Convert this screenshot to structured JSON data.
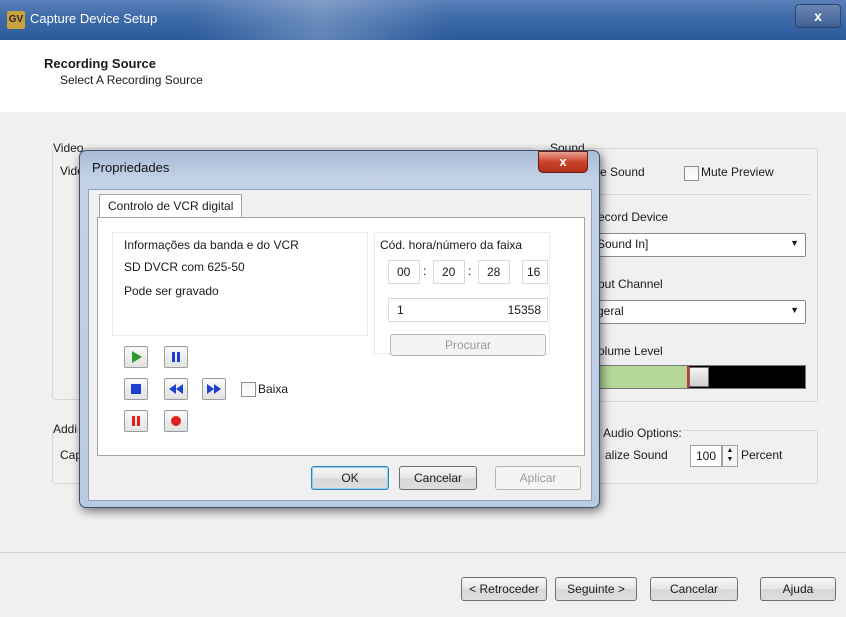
{
  "window": {
    "title": "Capture Device Setup",
    "logo": "GV",
    "close": "x"
  },
  "header": {
    "title": "Recording Source",
    "subtitle": "Select A Recording Source"
  },
  "video": {
    "group_label": "Video",
    "field_label_fragment": "Vide"
  },
  "sound": {
    "group_label": "Sound",
    "capture_sound_fragment": "re Sound",
    "mute_preview": "Mute Preview",
    "record_device_label": "ecord Device",
    "record_device_value": "Sound In]",
    "input_channel_label": "put Channel",
    "input_channel_value": "geral",
    "volume_label": "olume Level",
    "volume_level_fraction": 0.72
  },
  "additional": {
    "group_fragment": "Addi",
    "capture_fragment": "Cap",
    "audio_options_fragment": "Audio Options:",
    "normalize_fragment": "alize Sound",
    "percent_value": "100",
    "percent_label": "Percent"
  },
  "footer": {
    "back": "< Retroceder",
    "next": "Seguinte >",
    "cancel": "Cancelar",
    "help": "Ajuda"
  },
  "dialog": {
    "title": "Propriedades",
    "close": "x",
    "tab": "Controlo de VCR digital",
    "info_heading": "Informações da banda e do VCR",
    "device": "SD DVCR com 625-50",
    "status": "Pode ser gravado",
    "timecode_heading": "Cód. hora/número da faixa",
    "timecode": [
      "00",
      "20",
      "28",
      "16"
    ],
    "separator": ":",
    "track_left": "1",
    "track_right": "15358",
    "search_button": "Procurar",
    "low_checkbox": "Baixa",
    "ok": "OK",
    "cancel": "Cancelar",
    "apply": "Aplicar"
  },
  "icons": {
    "play": "play-icon",
    "pause": "pause-icon",
    "stop": "stop-icon",
    "rewind": "rewind-icon",
    "fast_forward": "fast-forward-icon",
    "record_pause": "record-pause-icon",
    "record": "record-icon"
  },
  "colors": {
    "play": "#2e9a2e",
    "transport_blue": "#1f3fd0",
    "record_red": "#e02020",
    "volume_green": "#b6d99a"
  }
}
